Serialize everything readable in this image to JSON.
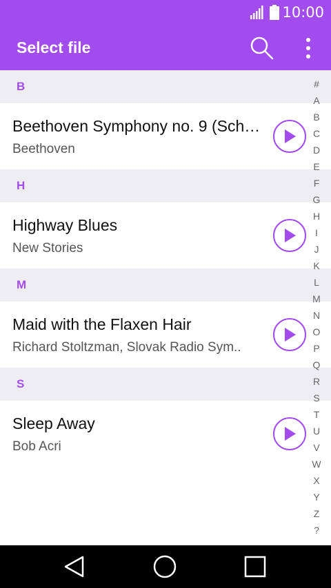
{
  "status_bar": {
    "time": "10:00"
  },
  "app_bar": {
    "title": "Select file"
  },
  "sections": [
    {
      "letter": "B",
      "items": [
        {
          "title": "Beethoven Symphony no. 9 (Sch…",
          "subtitle": "Beethoven"
        }
      ]
    },
    {
      "letter": "H",
      "items": [
        {
          "title": "Highway Blues",
          "subtitle": "New Stories"
        }
      ]
    },
    {
      "letter": "M",
      "items": [
        {
          "title": "Maid with the Flaxen Hair",
          "subtitle": "Richard Stoltzman, Slovak Radio Sym.."
        }
      ]
    },
    {
      "letter": "S",
      "items": [
        {
          "title": "Sleep Away",
          "subtitle": "Bob Acri"
        }
      ]
    }
  ],
  "index_letters": [
    "#",
    "A",
    "B",
    "C",
    "D",
    "E",
    "F",
    "G",
    "H",
    "I",
    "J",
    "K",
    "L",
    "M",
    "N",
    "O",
    "P",
    "Q",
    "R",
    "S",
    "T",
    "U",
    "V",
    "W",
    "X",
    "Y",
    "Z",
    "?"
  ],
  "colors": {
    "accent": "#a24cf0",
    "section_bg": "#eeeef2",
    "nav_bar": "#000000"
  }
}
